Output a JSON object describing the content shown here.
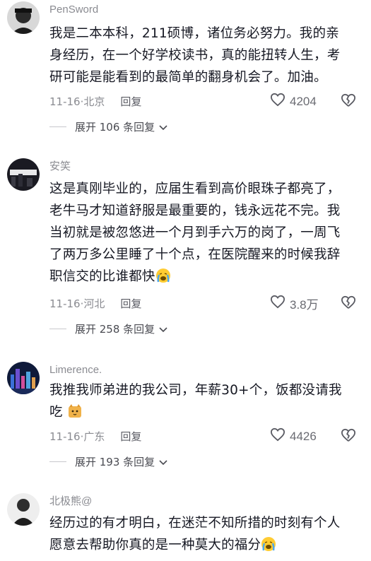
{
  "comments": [
    {
      "username": "PenSword",
      "lines": [
        "我是二本本科，211硕博，诸位务必努力。我的亲",
        "身经历，在一个好学校读书，真的能扭转人生，考",
        "研可能是能看到的最简单的翻身机会了。加油。"
      ],
      "date": "11-16",
      "location": "北京",
      "reply_label": "回复",
      "likes": "4204",
      "expand_label": "展开 106 条回复"
    },
    {
      "username": "安笑",
      "lines": [
        "这是真刚毕业的，应届生看到高价眼珠子都亮了，",
        "老牛马才知道舒服是最重要的，钱永远花不完。我",
        "当初就是被忽悠进一个月到手六万的岗了，一周飞",
        "了两万多公里睡了十个点，在医院醒来的时候我辞",
        "职信交的比谁都快"
      ],
      "date": "11-16",
      "location": "河北",
      "reply_label": "回复",
      "likes": "3.8万",
      "expand_label": "展开 258 条回复"
    },
    {
      "username": "Limerence.",
      "lines": [
        "我推我师弟进的我公司，年薪30+个，饭都没请我",
        "吃"
      ],
      "date": "11-16",
      "location": "广东",
      "reply_label": "回复",
      "likes": "4426",
      "expand_label": "展开 193 条回复"
    },
    {
      "username": "北极熊@",
      "lines": [
        "经历过的有才明白，在迷茫不知所措的时刻有个人",
        "愿意去帮助你真的是一种莫大的福分"
      ]
    }
  ],
  "icons": {
    "like": "heart-outline-icon",
    "dislike": "broken-heart-icon",
    "expand": "chevron-down-icon",
    "emoji_cry": "crying-emoji-icon",
    "emoji_sticker": "cat-sticker-icon"
  },
  "colors": {
    "text": "#161823",
    "meta": "#8a8b91",
    "background": "#ffffff"
  }
}
